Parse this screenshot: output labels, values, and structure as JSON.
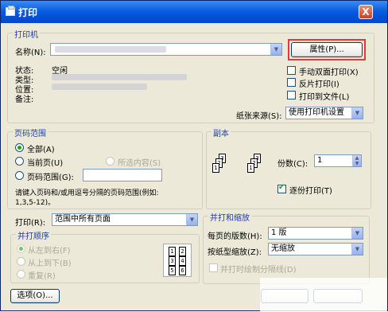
{
  "window": {
    "title": "打印",
    "close_glyph": "X"
  },
  "printer": {
    "group_label": "打印机",
    "name_label": "名称(N):",
    "properties_button": "属性(P)...",
    "status_label": "状态:",
    "status_value": "空闲",
    "type_label": "类型:",
    "location_label": "位置:",
    "comment_label": "备注:",
    "manual_duplex_label": "手动双面打印(X)",
    "reverse_print_label": "反片打印(I)",
    "print_to_file_label": "打印到文件(L)",
    "paper_source_label": "纸张来源(S):",
    "paper_source_value": "使用打印机设置"
  },
  "page_range": {
    "group_label": "页码范围",
    "all_label": "全部(A)",
    "current_page_label": "当前页(U)",
    "selection_label": "所选内容(S)",
    "pages_label": "页码范围(G):",
    "pages_value": "",
    "hint_line1": "请键入页码和/或用逗号分隔的页码范围(例如:",
    "hint_line2": "1,3,5-12)。"
  },
  "copies": {
    "group_label": "副本",
    "copies_label": "份数(C):",
    "copies_value": "1",
    "collate_label": "逐份打印(T)",
    "collate_checked": true
  },
  "print_what": {
    "label": "打印(R):",
    "value": "范围中所有页面"
  },
  "print_order": {
    "group_label": "并打顺序",
    "left_to_right": "从左到右(F)",
    "top_to_bottom": "从上到下(B)",
    "repeat": "重复(R)",
    "preview_pages": [
      "1",
      "2",
      "3",
      "4",
      "5",
      "6"
    ]
  },
  "zoom": {
    "group_label": "并打和缩放",
    "pages_per_sheet_label": "每页的版数(H):",
    "pages_per_sheet_value": "1 版",
    "scale_label": "按纸型缩放(Z):",
    "scale_value": "无缩放",
    "draw_borders_label": "并打时绘制分隔线(D)"
  },
  "footer": {
    "options_button": "选项(O)..."
  },
  "colors": {
    "title_blue": "#0a5ee0",
    "group_label_blue": "#1f3ea8",
    "highlight_red": "#e03b3b",
    "check_green": "#21a121"
  }
}
